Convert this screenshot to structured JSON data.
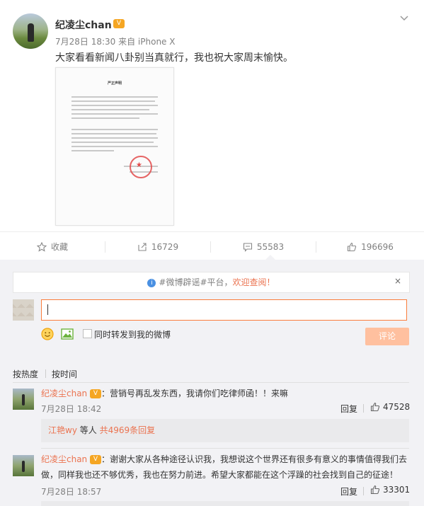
{
  "post": {
    "author": "纪凌尘chan",
    "vip_badge": "V",
    "meta": "7月28日 18:30 来自 iPhone X",
    "text": "大家看看新闻八卦别当真就行，我也祝大家周末愉快。",
    "image_doc_title": "严正声明"
  },
  "actions": {
    "favorite_label": "收藏",
    "repost_count": "16729",
    "comment_count": "55583",
    "like_count": "196696"
  },
  "notice": {
    "text_prefix": "#微博辟谣#平台，",
    "link_text": "欢迎查阅！",
    "close_label": "×"
  },
  "composer": {
    "input_value": "",
    "repost_checkbox_label": "同时转发到我的微博",
    "submit_label": "评论"
  },
  "sort": {
    "hot_label": "按热度",
    "time_label": "按时间"
  },
  "comments": [
    {
      "author": "纪凌尘chan",
      "text": "：营销号再乱发东西，我请你们吃律师函！！来嘛",
      "time": "7月28日 18:42",
      "reply_label": "回复",
      "likes": "47528",
      "replies_user": "江艳wy",
      "replies_mid": " 等人 ",
      "replies_total": "共4969条回复"
    },
    {
      "author": "纪凌尘chan",
      "text_line1": "：谢谢大家从各种途径认识我，我想说这个世界还有很多有意义的事情值得我们去",
      "text_line2": "做，同样我也还不够优秀，我也在努力前进。希望大家都能在这个浮躁的社会找到自己的征途！",
      "time": "7月28日 18:57",
      "reply_label": "回复",
      "likes": "33301"
    }
  ],
  "colors": {
    "accent": "#eb7350",
    "panel_bg": "#f2f2f5",
    "submit_disabled": "#ffc09f",
    "input_border": "#fa7d3c"
  }
}
